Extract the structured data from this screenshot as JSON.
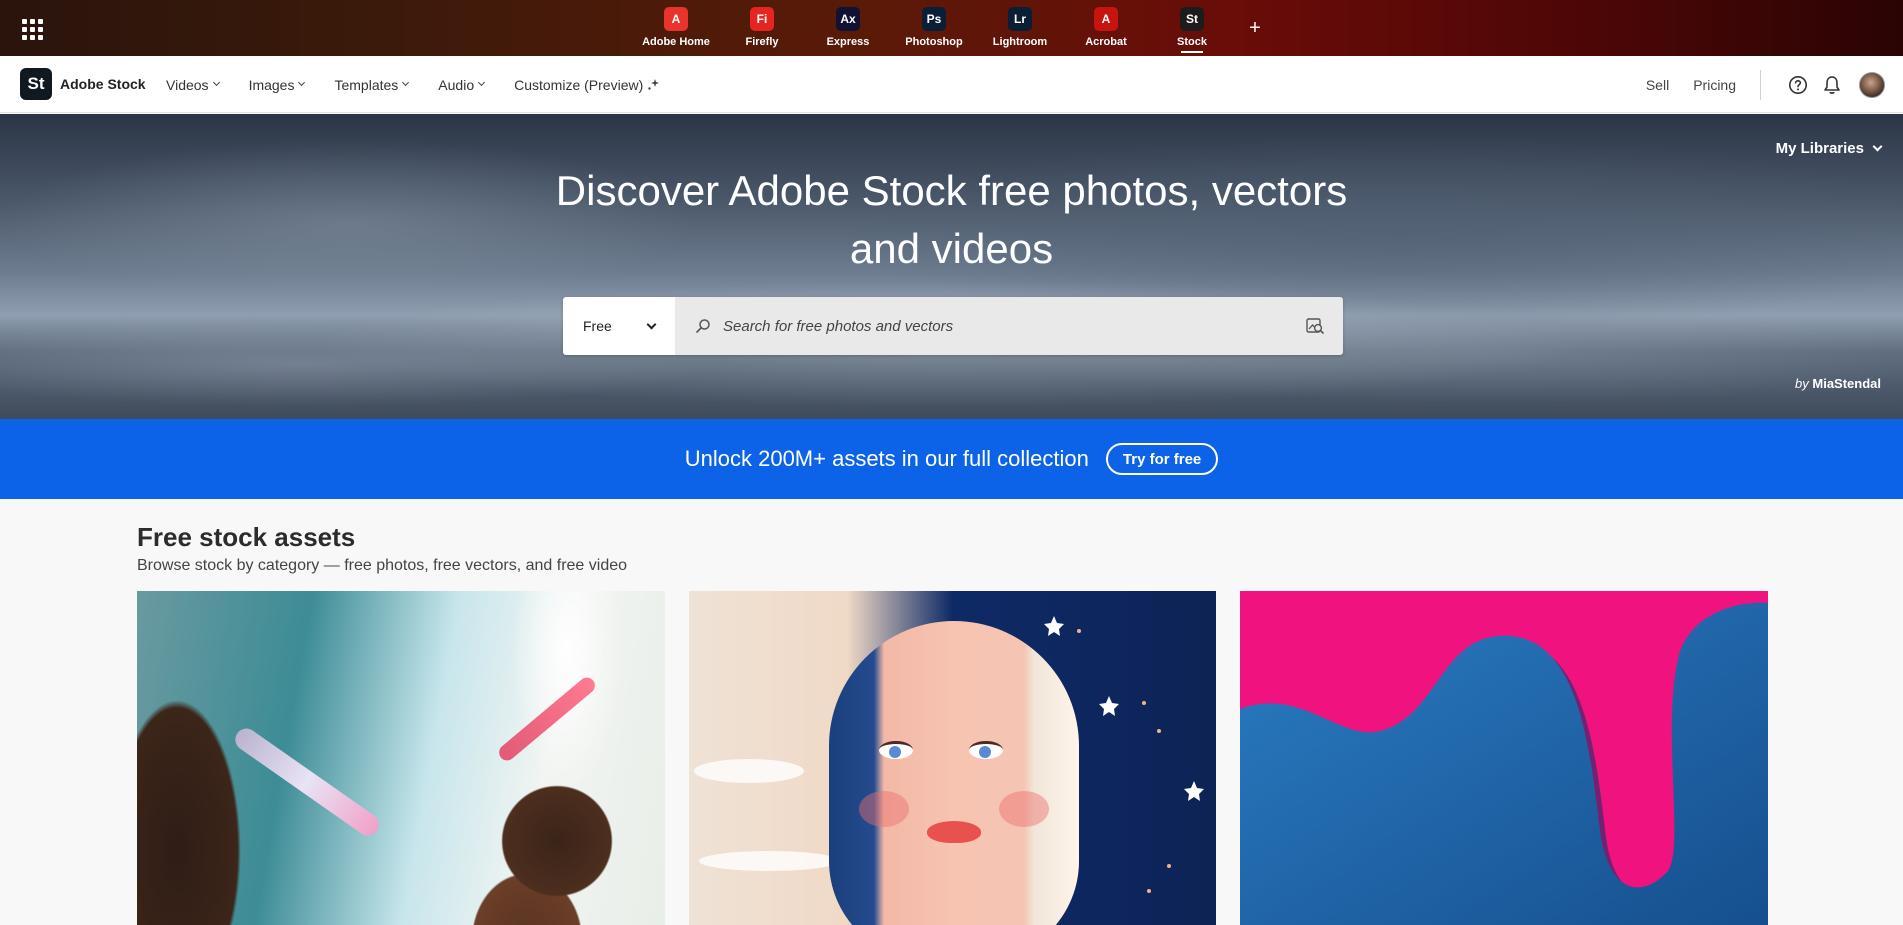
{
  "app_switcher": {
    "apps": [
      {
        "label": "Adobe Home",
        "glyph": "A",
        "color": "#e8342c",
        "active": false
      },
      {
        "label": "Firefly",
        "glyph": "Fi",
        "color": "#e52521",
        "active": false
      },
      {
        "label": "Express",
        "glyph": "Ax",
        "color": "#111133",
        "active": false
      },
      {
        "label": "Photoshop",
        "glyph": "Ps",
        "color": "#0a1e36",
        "active": false
      },
      {
        "label": "Lightroom",
        "glyph": "Lr",
        "color": "#0a1e36",
        "active": false
      },
      {
        "label": "Acrobat",
        "glyph": "A",
        "color": "#c8140f",
        "active": false
      },
      {
        "label": "Stock",
        "glyph": "St",
        "color": "#1c1c1c",
        "active": true
      }
    ],
    "add_label": "+"
  },
  "nav": {
    "brand_logo": "St",
    "brand_name": "Adobe Stock",
    "menu": [
      {
        "label": "Videos"
      },
      {
        "label": "Images"
      },
      {
        "label": "Templates"
      },
      {
        "label": "Audio"
      },
      {
        "label": "Customize (Preview)"
      }
    ],
    "sell": "Sell",
    "pricing": "Pricing"
  },
  "hero": {
    "title_line1": "Discover Adobe Stock free photos, vectors",
    "title_line2": "and videos",
    "my_libraries": "My Libraries",
    "search_filter": "Free",
    "search_placeholder": "Search for free photos and vectors",
    "credit_by": "by",
    "credit_author": "MiaStendal"
  },
  "promo": {
    "text": "Unlock 200M+ assets in our full collection",
    "button": "Try for free",
    "color": "#0c63e7"
  },
  "content": {
    "title": "Free stock assets",
    "subtitle": "Browse stock by category — free photos, free vectors, and free video"
  }
}
